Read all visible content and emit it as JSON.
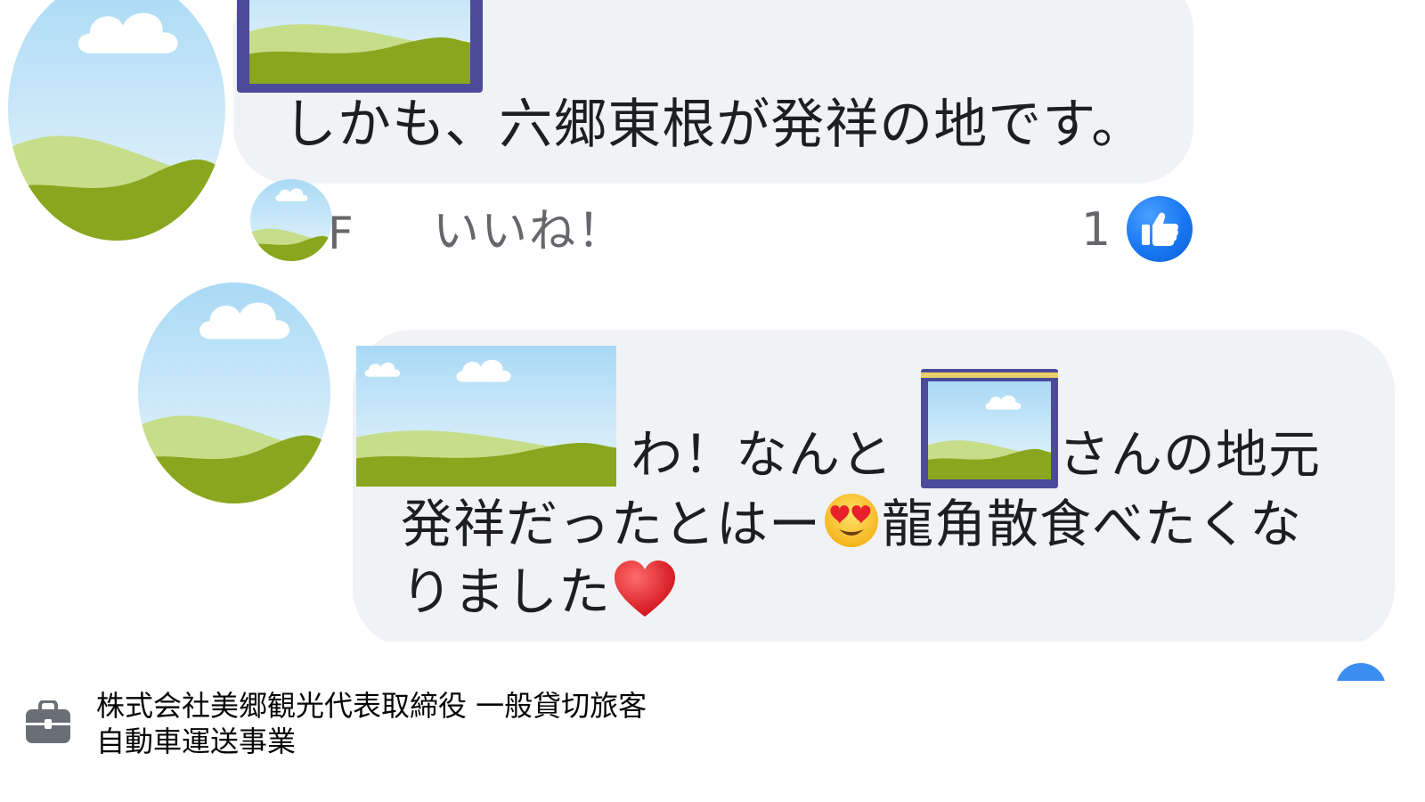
{
  "comments": [
    {
      "text": "しかも、六郷東根が発祥の地です。",
      "actions": {
        "reply_partial": "F",
        "like_label": "いいね！"
      },
      "reaction": {
        "count": "1",
        "icon": "thumbs-up-icon",
        "color": "#1877f2"
      }
    },
    {
      "line1_before": "わ！なんと",
      "line1_after": "さんの地元",
      "line2_before": "発祥だったとはー",
      "line2_emoji": "heart-eyes-emoji",
      "line2_after": "龍角散食べたくな",
      "line3_before": "りました",
      "line3_emoji": "red-heart-emoji"
    }
  ],
  "profile": {
    "work_icon": "briefcase-icon",
    "work_line1": "株式会社美郷観光代表取締役 一般貸切旅客",
    "work_line2": "自動車運送事業"
  },
  "colors": {
    "bubble": "#f0f2f5",
    "like_blue": "#1877f2",
    "secondary_text": "#65676b"
  }
}
